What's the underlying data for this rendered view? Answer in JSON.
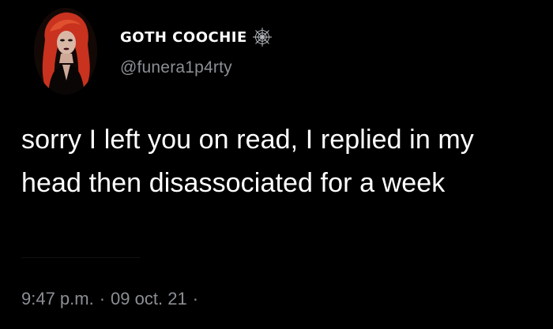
{
  "tweet": {
    "author": {
      "display_name": "GOTH COOCHIE",
      "handle": "@funera1p4rty",
      "badge_icon": "spiderweb-icon",
      "avatar_icon": "avatar-photo"
    },
    "text": "sorry I left you on read, I replied in my head then disassociated for a week",
    "time": "9:47 p.m.",
    "separator": "·",
    "date": "09 oct. 21",
    "trailing_separator": "·"
  },
  "colors": {
    "background": "#000000",
    "text": "#ffffff",
    "secondary_text": "#8b8f94",
    "avatar_hair": "#c8321e"
  }
}
